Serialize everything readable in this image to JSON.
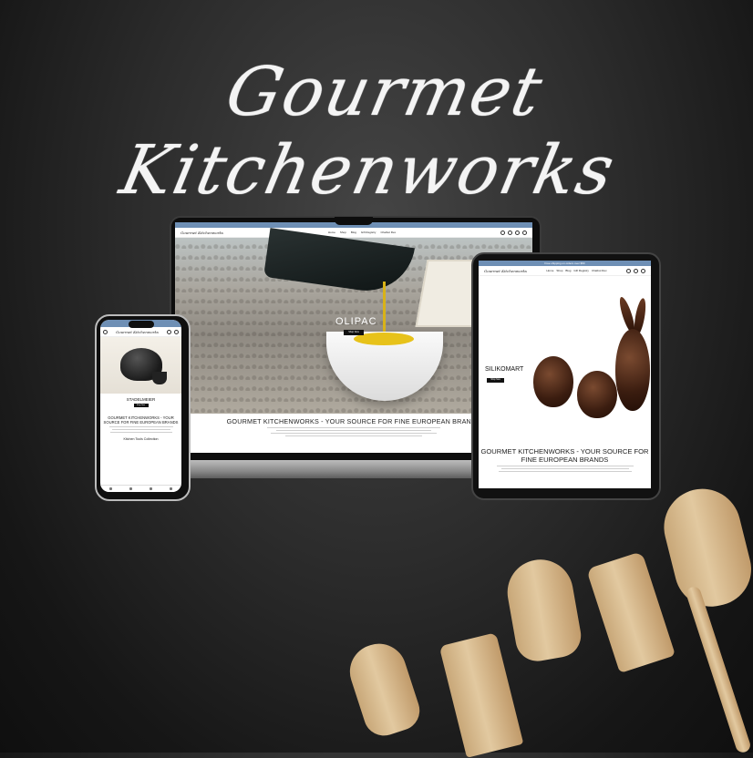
{
  "banner": {
    "title": "Gourmet Kitchenworks"
  },
  "colors": {
    "background": "#2c2c2c",
    "announcement_bar": "#6e8fb5",
    "wood": "#d8bc8f"
  },
  "site": {
    "logo": "Gourmet Kitchenworks",
    "nav": [
      "Home",
      "Shop",
      "Blog",
      "Gift Registry",
      "Chatbot Rex"
    ],
    "announcement": "Free shipping on orders over $50",
    "headline": "GOURMET KITCHENWORKS - YOUR SOURCE FOR FINE EUROPEAN BRANDS",
    "shop_now": "Shop Now"
  },
  "laptop": {
    "hero_brand": "OLIPAC"
  },
  "tablet": {
    "hero_brand": "SILIKOMART"
  },
  "phone": {
    "hero_brand": "STADELMEIER",
    "collection": "Kitchen Tools Collection"
  },
  "icons": [
    "search-icon",
    "user-icon",
    "heart-icon",
    "cart-icon"
  ]
}
